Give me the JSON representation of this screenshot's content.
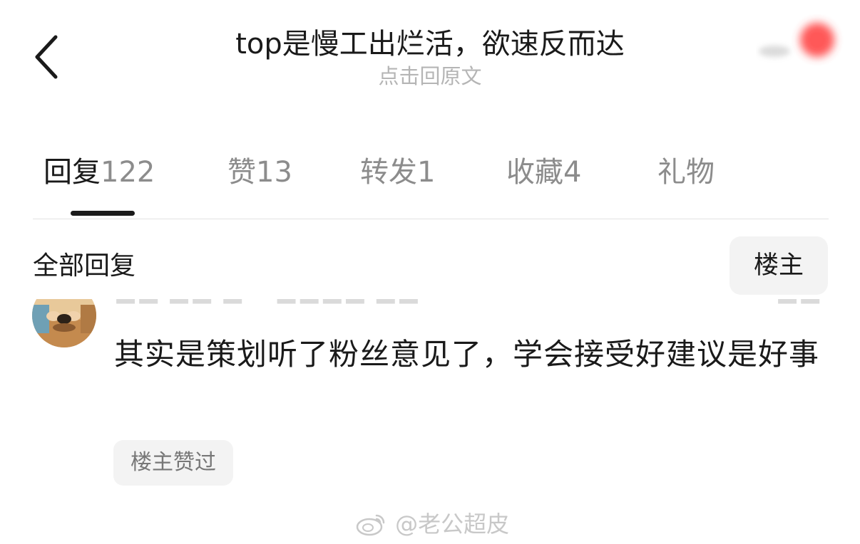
{
  "header": {
    "title": "top是慢工出烂活，欲速反而达",
    "subtitle": "点击回原文",
    "back_icon": "chevron-left-icon"
  },
  "tabs": [
    {
      "label": "回复",
      "count": "122",
      "active": true
    },
    {
      "label": "赞",
      "count": "13",
      "active": false
    },
    {
      "label": "转发",
      "count": "1",
      "active": false
    },
    {
      "label": "收藏",
      "count": "4",
      "active": false
    },
    {
      "label": "礼物",
      "count": "",
      "active": false
    }
  ],
  "section": {
    "title": "全部回复",
    "op_filter_label": "楼主"
  },
  "comment": {
    "text": "其实是策划听了粉丝意见了，学会接受好建议是好事",
    "op_liked_badge": "楼主赞过"
  },
  "watermark": {
    "text": "@老公超皮",
    "icon": "weibo-logo-icon"
  },
  "colors": {
    "text_primary": "#1a1a1a",
    "text_secondary": "#8c8c8c",
    "text_muted": "#b5b5b5",
    "chip_bg": "#f3f3f3",
    "divider": "#e3e3e3"
  }
}
